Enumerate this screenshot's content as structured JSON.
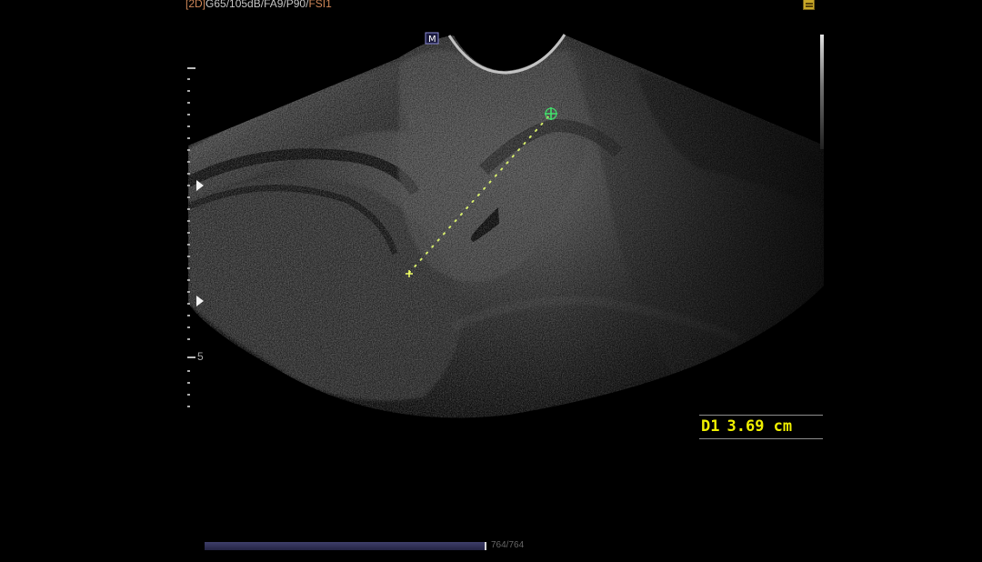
{
  "status_bar": {
    "mode": "[2D]",
    "parameters": "G65/105dB/FA9/P90/",
    "fsi": "FSI1"
  },
  "probe_indicator": {
    "label": "M"
  },
  "scale": {
    "depth_label": "5"
  },
  "measurement": {
    "name": "D1",
    "value": "3.69 cm"
  },
  "cine": {
    "progress": 1.0,
    "frame_label": "764/764"
  },
  "colors": {
    "measurement": "#f0f000",
    "caliper_start": "#f1ff64",
    "caliper_end": "#41e36c",
    "mode_label": "#cf8758",
    "grayscale_bright": "#f0f0f0"
  },
  "icons": {
    "top_right_indicator": "yellow-status-icon",
    "caliper": "plus-cross-icon",
    "focus": "right-triangle-icon"
  }
}
